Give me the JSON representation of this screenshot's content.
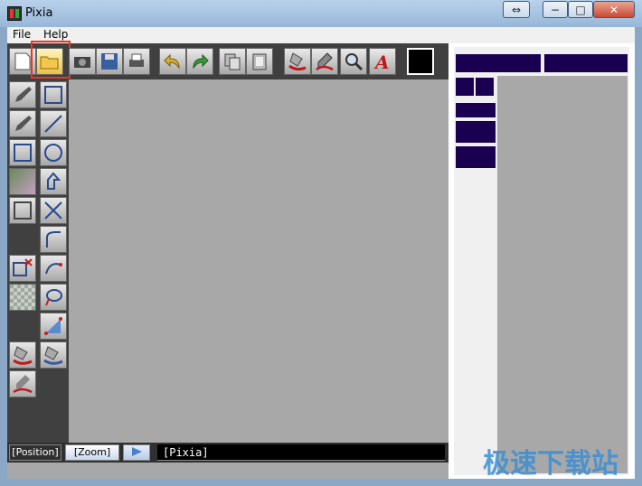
{
  "window": {
    "title": "Pixia",
    "resize_glyph": "⇔",
    "minimize_glyph": "−",
    "maximize_glyph": "□",
    "close_glyph": "✕"
  },
  "menu": {
    "file": "File",
    "help": "Help"
  },
  "toolbar": {
    "icons": [
      "new-icon",
      "open-folder-icon",
      "camera-icon",
      "save-icon",
      "print-icon",
      "undo-icon",
      "redo-icon",
      "copy-icon",
      "paste-icon",
      "fill-red-icon",
      "pen-red-icon",
      "zoom-icon",
      "text-icon",
      "color-black-swatch"
    ],
    "selected": "open-folder-icon",
    "highlight_color": "#e32222"
  },
  "status": {
    "position": "[Position]",
    "zoom": "[Zoom]",
    "app": "[Pixia]"
  },
  "watermark": "极速下载站",
  "colors": {
    "panel_dark": "#1a0050",
    "toolbar_bg": "#404040",
    "canvas_bg": "#a8a8a8"
  }
}
